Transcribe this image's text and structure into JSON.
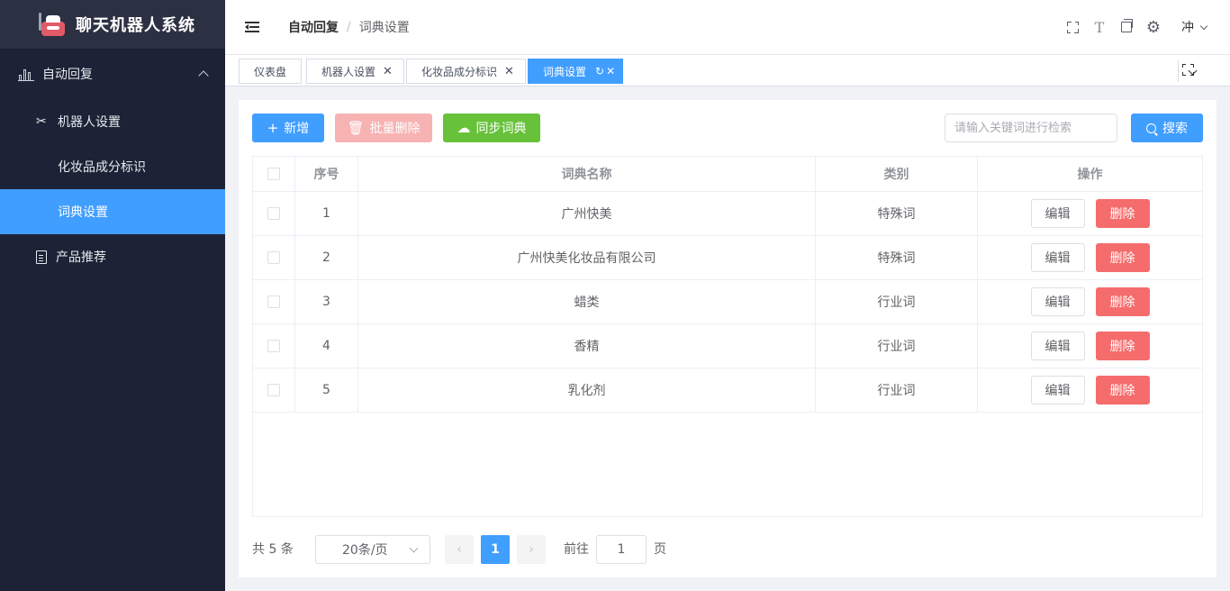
{
  "app": {
    "title": "聊天机器人系统"
  },
  "sidebar": {
    "group": {
      "label": "自动回复"
    },
    "items": [
      {
        "label": "机器人设置",
        "icon": "tools-icon"
      },
      {
        "label": "化妆品成分标识",
        "icon": "grid-icon"
      },
      {
        "label": "词典设置",
        "icon": "grid-icon",
        "active": true
      },
      {
        "label": "产品推荐",
        "icon": "document-icon"
      }
    ]
  },
  "header": {
    "breadcrumb": [
      "自动回复",
      "词典设置"
    ],
    "user": "冲"
  },
  "tags": [
    {
      "label": "仪表盘"
    },
    {
      "label": "机器人设置"
    },
    {
      "label": "化妆品成分标识"
    },
    {
      "label": "词典设置",
      "active": true
    }
  ],
  "toolbar": {
    "add_label": "新增",
    "batch_delete_label": "批量删除",
    "sync_label": "同步词典",
    "search_placeholder": "请输入关键词进行检索",
    "search_label": "搜索"
  },
  "table": {
    "columns": [
      "序号",
      "词典名称",
      "类别",
      "操作"
    ],
    "rows": [
      {
        "no": "1",
        "name": "广州快美",
        "type": "特殊词"
      },
      {
        "no": "2",
        "name": "广州快美化妆品有限公司",
        "type": "特殊词"
      },
      {
        "no": "3",
        "name": "蜡类",
        "type": "行业词"
      },
      {
        "no": "4",
        "name": "香精",
        "type": "行业词"
      },
      {
        "no": "5",
        "name": "乳化剂",
        "type": "行业词"
      }
    ],
    "edit_label": "编辑",
    "delete_label": "删除"
  },
  "pagination": {
    "total_text": "共 5 条",
    "page_size": "20条/页",
    "current_page": "1",
    "goto_label": "前往",
    "goto_value": "1",
    "unit": "页"
  },
  "colors": {
    "primary": "#409eff",
    "danger": "#f56c6c",
    "success": "#67c23a",
    "sidebar": "#1d2336"
  }
}
